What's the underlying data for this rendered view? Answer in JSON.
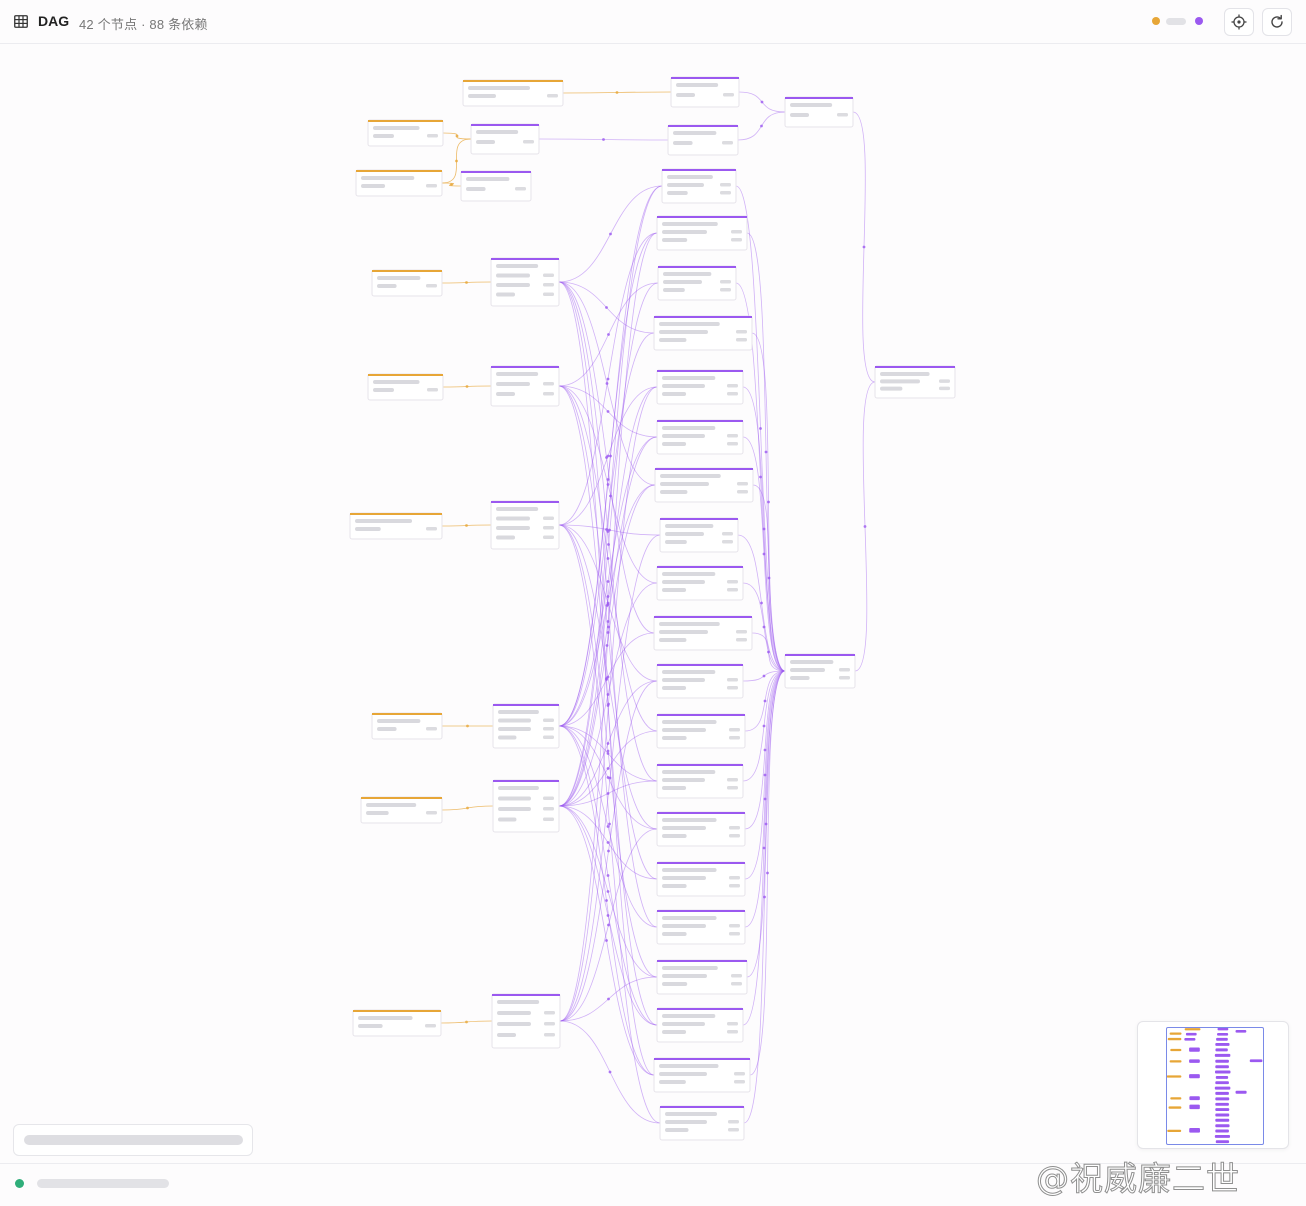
{
  "header": {
    "title": "DAG",
    "subtitle": "42 个节点 · 88 条依赖",
    "icon": "table-icon"
  },
  "legend": {
    "source_color": "#e7a637",
    "model_color": "#9b59f0"
  },
  "toolbar": {
    "locate_icon": "target-icon",
    "refresh_icon": "refresh-icon"
  },
  "status": {
    "color": "#2fae7a"
  },
  "watermark": {
    "text": "@祝威廉二世"
  }
}
